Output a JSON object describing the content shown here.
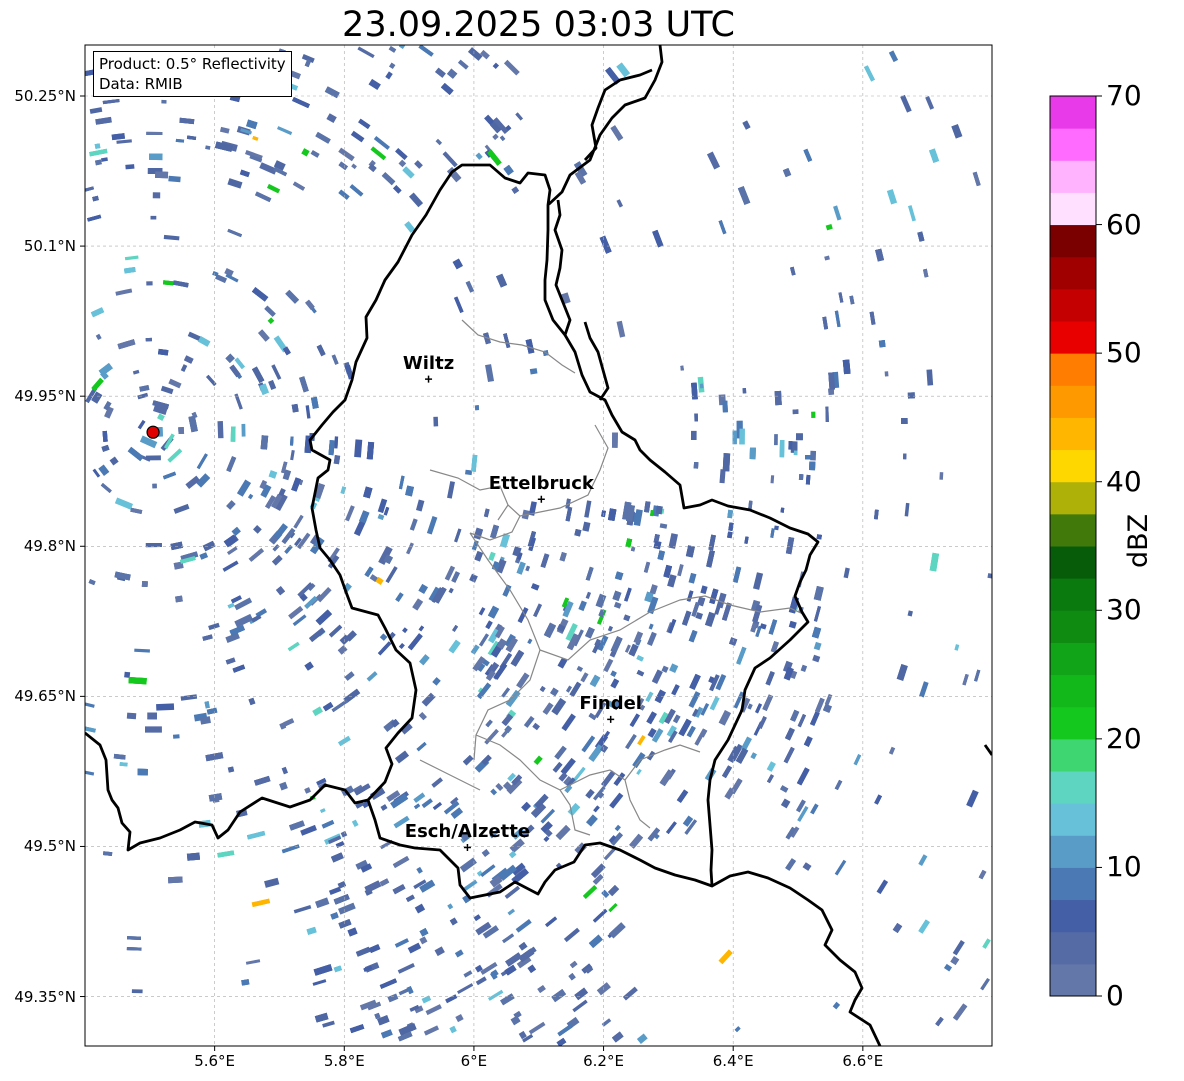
{
  "title": "23.09.2025 03:03 UTC",
  "info_box": {
    "product": "Product: 0.5° Reflectivity",
    "source": "Data: RMIB"
  },
  "map_extent": {
    "lon_min": 5.4,
    "lon_max": 6.8,
    "lat_min": 49.3,
    "lat_max": 50.3
  },
  "lat_ticks": [
    {
      "value": 50.25,
      "label": "50.25°N"
    },
    {
      "value": 50.1,
      "label": "50.1°N"
    },
    {
      "value": 49.95,
      "label": "49.95°N"
    },
    {
      "value": 49.8,
      "label": "49.8°N"
    },
    {
      "value": 49.65,
      "label": "49.65°N"
    },
    {
      "value": 49.5,
      "label": "49.5°N"
    },
    {
      "value": 49.35,
      "label": "49.35°N"
    }
  ],
  "lon_ticks": [
    {
      "value": 5.6,
      "label": "5.6°E"
    },
    {
      "value": 5.8,
      "label": "5.8°E"
    },
    {
      "value": 6.0,
      "label": "6°E"
    },
    {
      "value": 6.2,
      "label": "6.2°E"
    },
    {
      "value": 6.4,
      "label": "6.4°E"
    },
    {
      "value": 6.6,
      "label": "6.6°E"
    }
  ],
  "cities": [
    {
      "name": "Wiltz",
      "lon": 5.93,
      "lat": 49.967
    },
    {
      "name": "Ettelbruck",
      "lon": 6.104,
      "lat": 49.847
    },
    {
      "name": "Findel",
      "lon": 6.211,
      "lat": 49.627
    },
    {
      "name": "Esch/Alzette",
      "lon": 5.99,
      "lat": 49.499
    }
  ],
  "radar_site": {
    "lon": 5.505,
    "lat": 49.914
  },
  "colorbar": {
    "label": "dBZ",
    "min": 0,
    "max": 70,
    "ticks": [
      "0",
      "10",
      "20",
      "30",
      "40",
      "50",
      "60",
      "70"
    ],
    "colors": [
      "#6477a9",
      "#556ba6",
      "#445fa6",
      "#4a79b4",
      "#5a9cc8",
      "#67c1d9",
      "#5ed5c0",
      "#3ed670",
      "#14c81e",
      "#12b81a",
      "#12a418",
      "#0f8b12",
      "#0a7a0f",
      "#075c0a",
      "#417a0a",
      "#aeb107",
      "#ffd700",
      "#ffb600",
      "#ff9900",
      "#ff7d00",
      "#e80000",
      "#c40000",
      "#a00000",
      "#7a0000",
      "#ffe0ff",
      "#ffb3ff",
      "#ff6aff",
      "#e83ae8"
    ]
  }
}
